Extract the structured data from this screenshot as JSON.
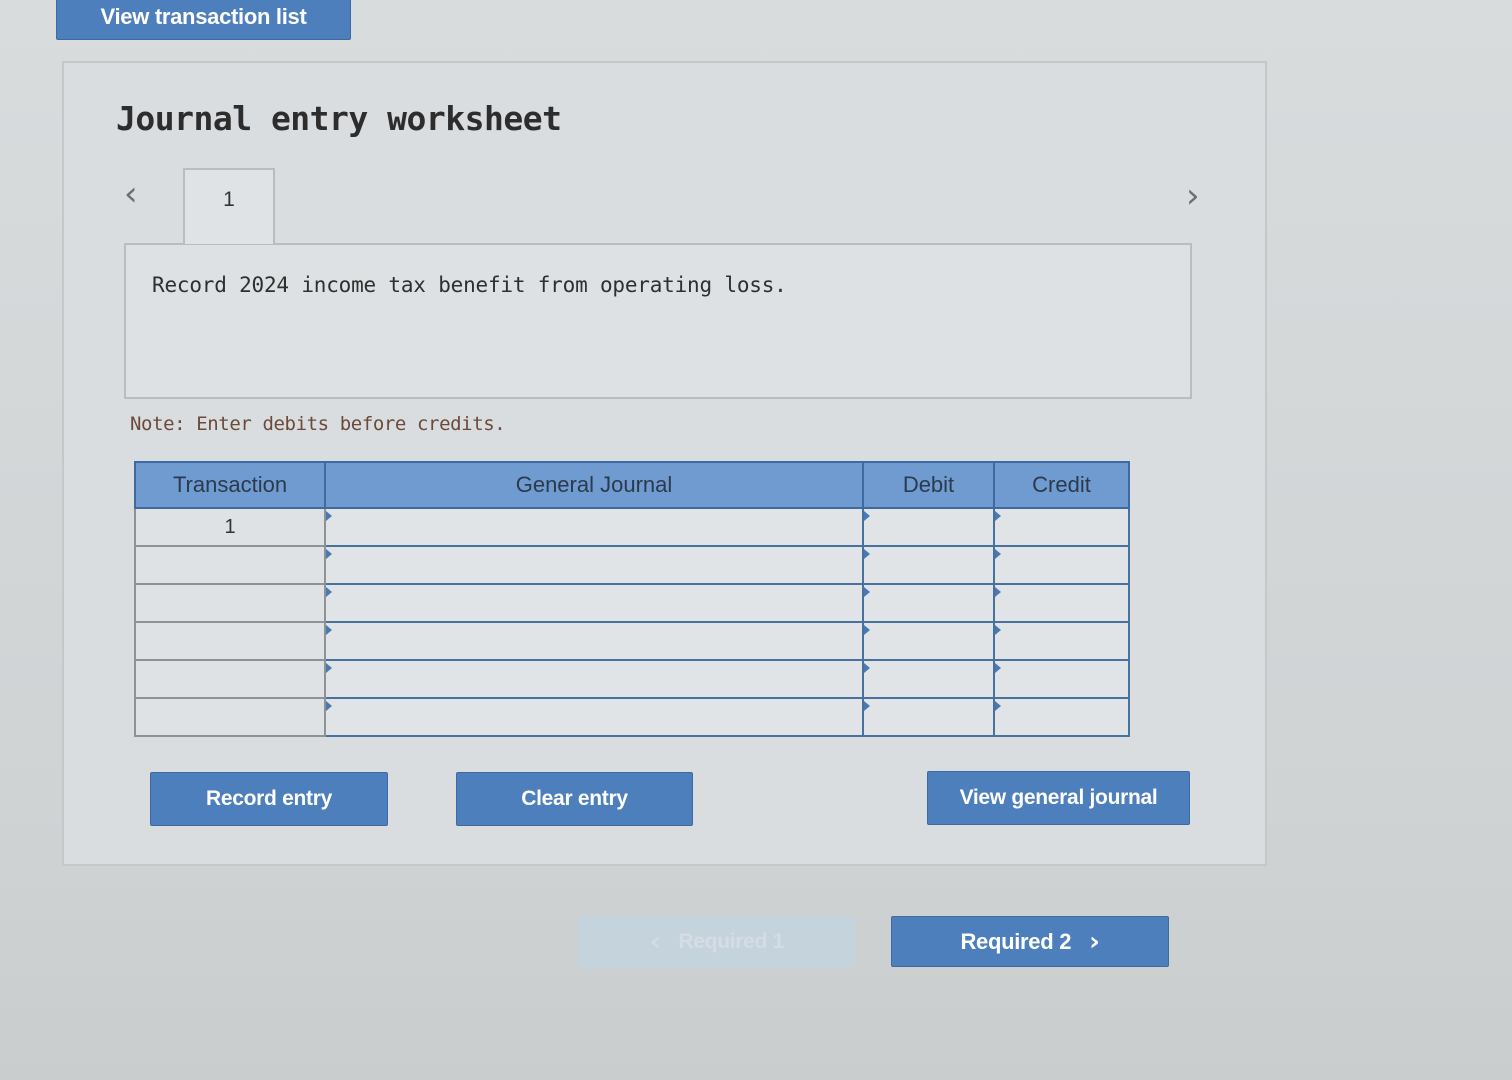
{
  "header": {
    "view_transaction_list_label": "View transaction list"
  },
  "worksheet": {
    "title": "Journal entry worksheet",
    "tabs": [
      {
        "label": "1",
        "active": true
      }
    ],
    "description": "Record 2024 income tax benefit from operating loss.",
    "note": "Note: Enter debits before credits.",
    "table": {
      "columns": [
        "Transaction",
        "General Journal",
        "Debit",
        "Credit"
      ],
      "rows": [
        {
          "transaction": "1",
          "account": "",
          "debit": "",
          "credit": ""
        },
        {
          "transaction": "",
          "account": "",
          "debit": "",
          "credit": ""
        },
        {
          "transaction": "",
          "account": "",
          "debit": "",
          "credit": ""
        },
        {
          "transaction": "",
          "account": "",
          "debit": "",
          "credit": ""
        },
        {
          "transaction": "",
          "account": "",
          "debit": "",
          "credit": ""
        },
        {
          "transaction": "",
          "account": "",
          "debit": "",
          "credit": ""
        }
      ]
    },
    "actions": {
      "record_entry": "Record entry",
      "clear_entry": "Clear entry",
      "view_general_journal": "View general journal"
    }
  },
  "footer_nav": {
    "prev_label": "Required 1",
    "next_label": "Required 2"
  },
  "icons": {
    "prev_tab": "chevron-left-icon",
    "next_tab": "chevron-right-icon"
  },
  "colors": {
    "primary_button": "#4e7fbd",
    "table_header": "#6f9bd0",
    "disabled_button": "#c5d3dd"
  }
}
